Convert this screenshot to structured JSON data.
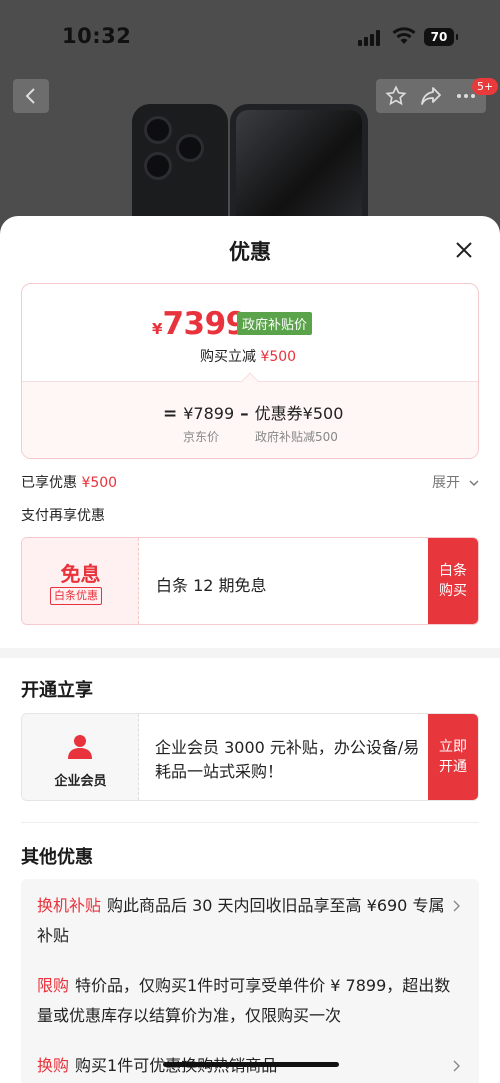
{
  "status_bar": {
    "time": "10:32",
    "battery": "70"
  },
  "nav": {
    "badge": "5+"
  },
  "sheet": {
    "title": "优惠",
    "price_card": {
      "currency": "¥",
      "price": "7399",
      "gov_tag": "政府补贴价",
      "buy_reduce_label": "购买立减",
      "buy_reduce_amount": "¥500",
      "formula": {
        "eq": "=",
        "jd_price": "¥7899",
        "minus": "–",
        "coupon": "优惠券¥500"
      },
      "sub_jd": "京东价",
      "sub_gov": "政府补贴减500"
    },
    "enjoyed_label": "已享优惠",
    "enjoyed_amount": "¥500",
    "expand_label": "展开",
    "pay_more_label": "支付再享优惠",
    "baitiao": {
      "big": "免息",
      "tag": "白条优惠",
      "desc": "白条 12 期免息",
      "button": "白条\n购买"
    },
    "open_section_title": "开通立享",
    "member": {
      "icon": "person-icon",
      "label": "企业会员",
      "desc": "企业会员 3000 元补贴，办公设备/易耗品一站式采购！",
      "button": "立即\n开通"
    },
    "other_section_title": "其他优惠",
    "other_items": [
      {
        "tag": "换机补贴",
        "text": "购此商品后 30 天内回收旧品享至高 ¥690 专属补贴"
      },
      {
        "tag": "限购",
        "text": "特价品，仅购买1件时可享受单件价 ¥ 7899，超出数量或优惠库存以结算价为准，仅限购买一次"
      },
      {
        "tag": "换购",
        "text": "购买1件可优惠换购热销商品"
      }
    ]
  },
  "colors": {
    "accent": "#e8323c",
    "gov_green": "#5aa34b"
  }
}
